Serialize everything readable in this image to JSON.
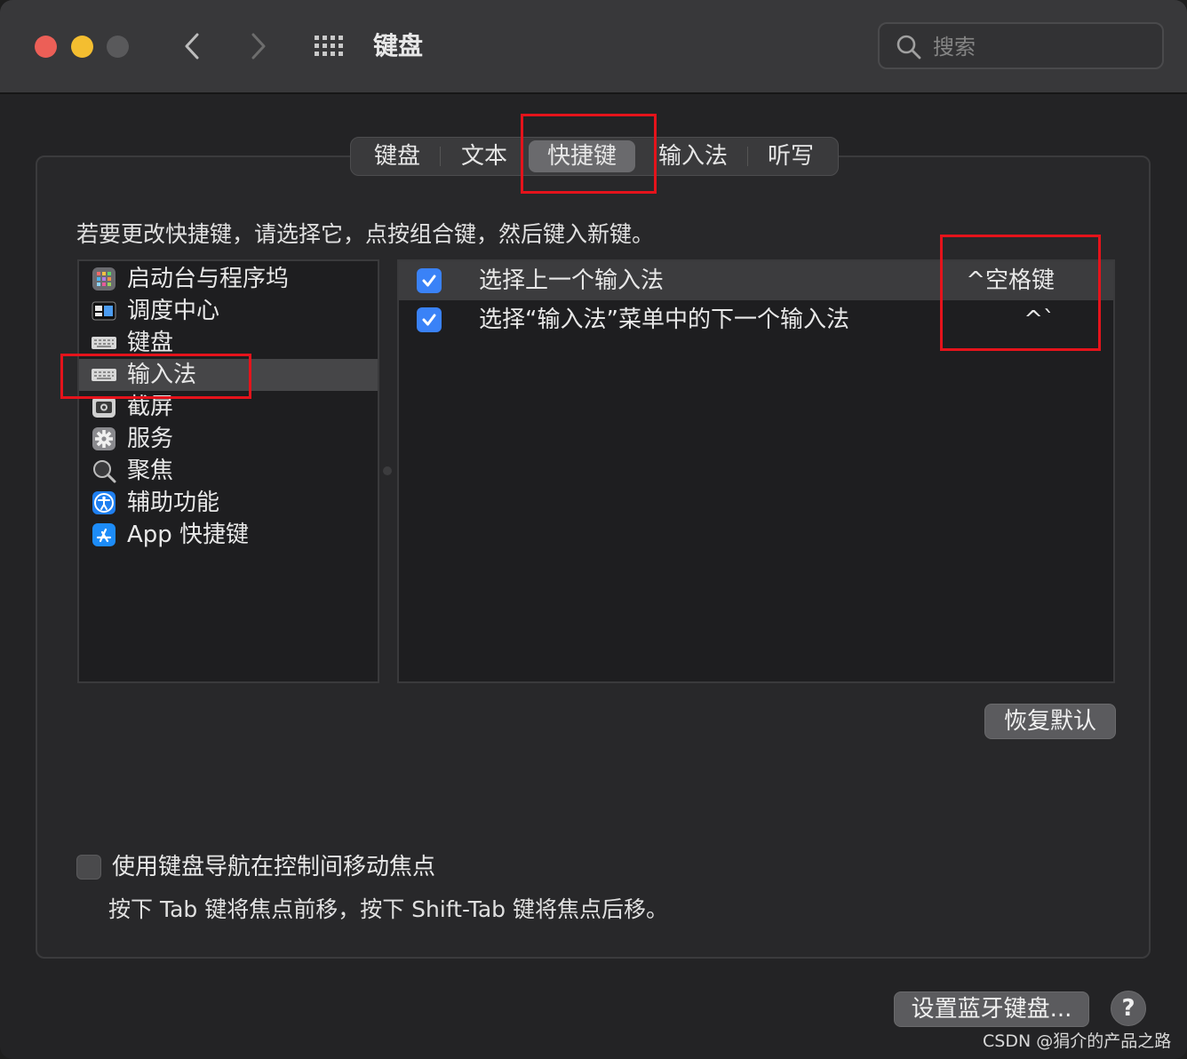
{
  "window": {
    "title": "键盘",
    "search_placeholder": "搜索"
  },
  "tabs": [
    {
      "label": "键盘"
    },
    {
      "label": "文本"
    },
    {
      "label": "快捷键",
      "active": true
    },
    {
      "label": "输入法"
    },
    {
      "label": "听写"
    }
  ],
  "instructions": "若要更改快捷键，请选择它，点按组合键，然后键入新键。",
  "categories": [
    {
      "label": "启动台与程序坞",
      "icon": "launchpad-icon"
    },
    {
      "label": "调度中心",
      "icon": "mission-control-icon"
    },
    {
      "label": "键盘",
      "icon": "keyboard-icon"
    },
    {
      "label": "输入法",
      "icon": "keyboard-icon",
      "selected": true
    },
    {
      "label": "截屏",
      "icon": "screenshot-icon"
    },
    {
      "label": "服务",
      "icon": "gear-icon"
    },
    {
      "label": "聚焦",
      "icon": "magnifier-icon"
    },
    {
      "label": "辅助功能",
      "icon": "accessibility-icon"
    },
    {
      "label": "App 快捷键",
      "icon": "app-store-icon"
    }
  ],
  "shortcuts": [
    {
      "checked": true,
      "label": "选择上一个输入法",
      "key": "^空格键"
    },
    {
      "checked": true,
      "label": "选择“输入法”菜单中的下一个输入法",
      "key": "^`"
    }
  ],
  "buttons": {
    "restore_defaults": "恢复默认",
    "setup_bluetooth": "设置蓝牙键盘...",
    "help": "?"
  },
  "keyboard_navigation": {
    "checked": false,
    "label": "使用键盘导航在控制间移动焦点",
    "description": "按下 Tab 键将焦点前移，按下 Shift-Tab 键将焦点后移。"
  },
  "watermark": "CSDN @狷介的产品之路",
  "colors": {
    "accent": "#3a82f7",
    "annotation": "#e5131b"
  }
}
